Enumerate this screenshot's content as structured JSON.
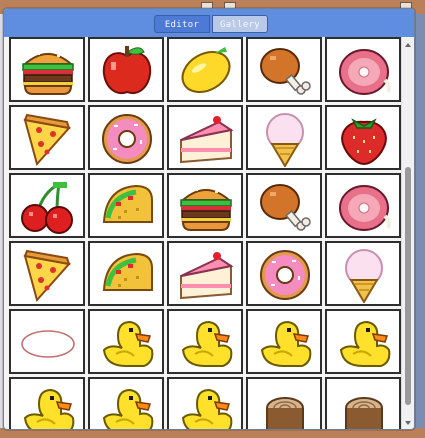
{
  "window": {
    "tabs": [
      {
        "label": "Editor",
        "active": true
      },
      {
        "label": "Gallery",
        "active": false
      }
    ]
  },
  "gallery": {
    "items": [
      {
        "icon": "hamburger-icon"
      },
      {
        "icon": "apple-icon"
      },
      {
        "icon": "lemon-icon"
      },
      {
        "icon": "drumstick-icon"
      },
      {
        "icon": "ham-icon"
      },
      {
        "icon": "pizza-slice-icon"
      },
      {
        "icon": "donut-icon"
      },
      {
        "icon": "cake-slice-icon"
      },
      {
        "icon": "ice-cream-icon"
      },
      {
        "icon": "strawberry-icon"
      },
      {
        "icon": "cherries-icon"
      },
      {
        "icon": "taco-icon"
      },
      {
        "icon": "hamburger-icon"
      },
      {
        "icon": "drumstick-icon"
      },
      {
        "icon": "ham-icon"
      },
      {
        "icon": "pizza-slice-icon"
      },
      {
        "icon": "taco-icon"
      },
      {
        "icon": "cake-slice-icon"
      },
      {
        "icon": "donut-icon"
      },
      {
        "icon": "ice-cream-icon"
      },
      {
        "icon": "oval-outline-icon"
      },
      {
        "icon": "rubber-duck-icon"
      },
      {
        "icon": "rubber-duck-icon"
      },
      {
        "icon": "rubber-duck-icon"
      },
      {
        "icon": "rubber-duck-icon"
      },
      {
        "icon": "rubber-duck-icon"
      },
      {
        "icon": "rubber-duck-icon"
      },
      {
        "icon": "rubber-duck-icon"
      },
      {
        "icon": "wood-log-icon"
      },
      {
        "icon": "wood-log-icon"
      }
    ]
  },
  "colors": {
    "titlebar": "#5f8ee0",
    "cell_border": "#2e2e2e",
    "window_bg": "#f4f4f4"
  }
}
